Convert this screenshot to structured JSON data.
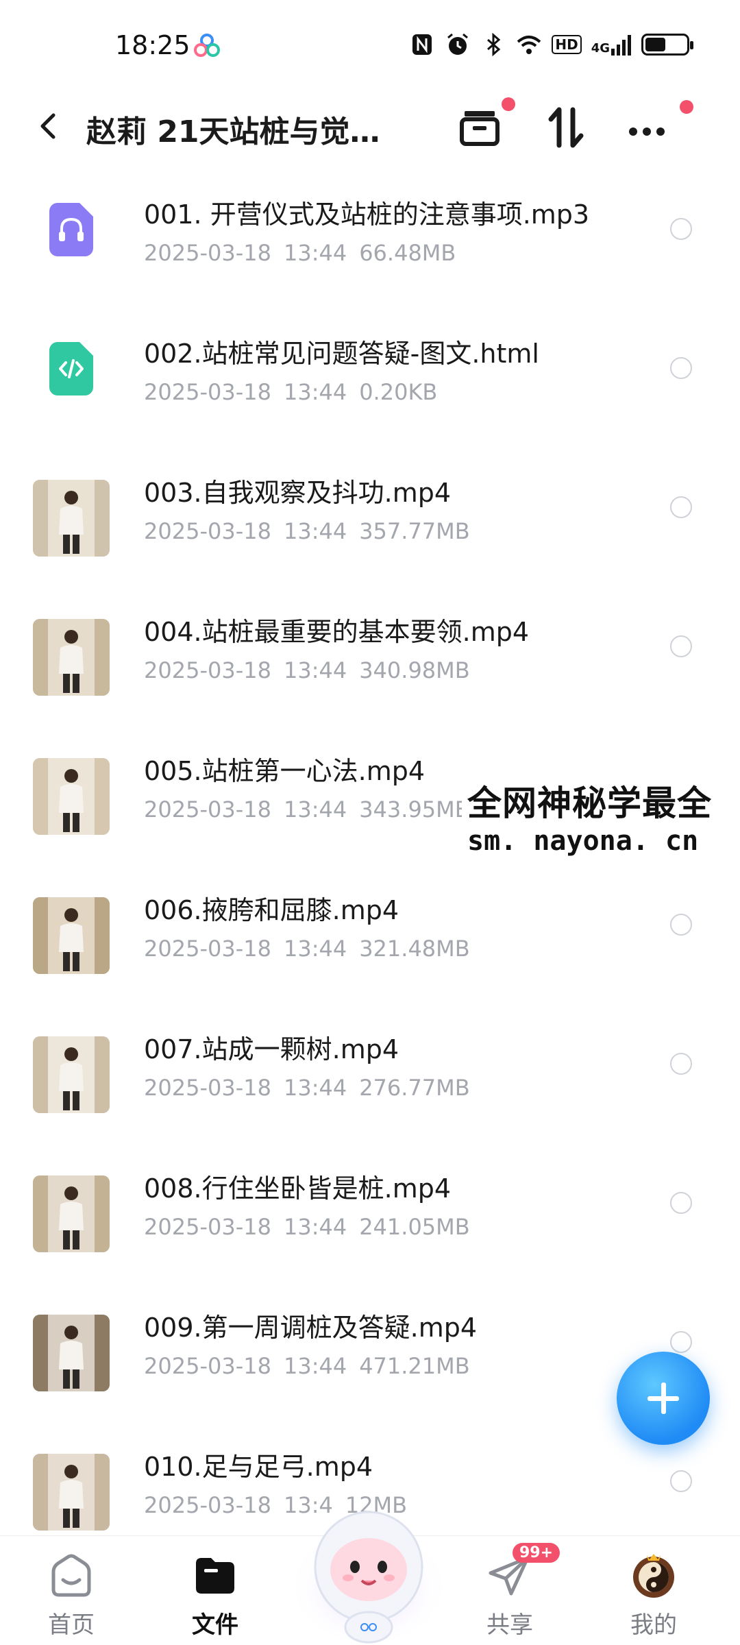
{
  "status_bar": {
    "time": "18:25",
    "network_label": "4G",
    "hd_label": "HD",
    "battery_level": 0.5
  },
  "header": {
    "title": "赵莉 21天站桩与觉…"
  },
  "files": [
    {
      "name": "001. 开营仪式及站桩的注意事项.mp3",
      "date": "2025-03-18",
      "time": "13:44",
      "size": "66.48MB",
      "kind": "audio"
    },
    {
      "name": "002.站桩常见问题答疑-图文.html",
      "date": "2025-03-18",
      "time": "13:44",
      "size": "0.20KB",
      "kind": "html"
    },
    {
      "name": "003.自我观察及抖功.mp4",
      "date": "2025-03-18",
      "time": "13:44",
      "size": "357.77MB",
      "kind": "video"
    },
    {
      "name": "004.站桩最重要的基本要领.mp4",
      "date": "2025-03-18",
      "time": "13:44",
      "size": "340.98MB",
      "kind": "video"
    },
    {
      "name": "005.站桩第一心法.mp4",
      "date": "2025-03-18",
      "time": "13:44",
      "size": "343.95MB",
      "kind": "video"
    },
    {
      "name": "006.掖胯和屈膝.mp4",
      "date": "2025-03-18",
      "time": "13:44",
      "size": "321.48MB",
      "kind": "video"
    },
    {
      "name": "007.站成一颗树.mp4",
      "date": "2025-03-18",
      "time": "13:44",
      "size": "276.77MB",
      "kind": "video"
    },
    {
      "name": "008.行住坐卧皆是桩.mp4",
      "date": "2025-03-18",
      "time": "13:44",
      "size": "241.05MB",
      "kind": "video"
    },
    {
      "name": "009.第一周调桩及答疑.mp4",
      "date": "2025-03-18",
      "time": "13:44",
      "size": "471.21MB",
      "kind": "video"
    },
    {
      "name": "010.足与足弓.mp4",
      "date": "2025-03-18",
      "time": "13:4",
      "size": "12MB",
      "kind": "video"
    }
  ],
  "watermark": {
    "line1": "全网神秘学最全",
    "line2": "sm. nayona. cn"
  },
  "bottom_nav": {
    "home": "首页",
    "files": "文件",
    "share": "共享",
    "share_badge": "99+",
    "mine": "我的"
  },
  "colors": {
    "accent": "#1f8bf5",
    "badge": "#f2506b",
    "audio_icon": "#8b7cf6",
    "html_icon": "#2fc8a0",
    "meta_text": "#a3a6ad"
  }
}
